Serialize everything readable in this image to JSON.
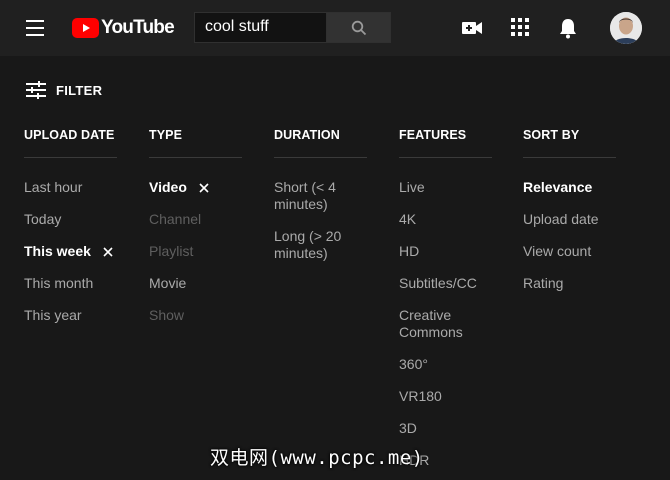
{
  "header": {
    "logo_text": "YouTube",
    "search_value": "cool stuff"
  },
  "filter": {
    "label": "FILTER"
  },
  "columns": [
    {
      "title": "UPLOAD DATE",
      "options": [
        {
          "label": "Last hour",
          "state": "normal"
        },
        {
          "label": "Today",
          "state": "normal"
        },
        {
          "label": "This week",
          "state": "selected"
        },
        {
          "label": "This month",
          "state": "normal"
        },
        {
          "label": "This year",
          "state": "normal"
        }
      ]
    },
    {
      "title": "TYPE",
      "options": [
        {
          "label": "Video",
          "state": "selected"
        },
        {
          "label": "Channel",
          "state": "disabled"
        },
        {
          "label": "Playlist",
          "state": "disabled"
        },
        {
          "label": "Movie",
          "state": "normal"
        },
        {
          "label": "Show",
          "state": "disabled"
        }
      ]
    },
    {
      "title": "DURATION",
      "options": [
        {
          "label": "Short (< 4 minutes)",
          "state": "normal"
        },
        {
          "label": "Long (> 20 minutes)",
          "state": "normal"
        }
      ]
    },
    {
      "title": "FEATURES",
      "options": [
        {
          "label": "Live",
          "state": "normal"
        },
        {
          "label": "4K",
          "state": "normal"
        },
        {
          "label": "HD",
          "state": "normal"
        },
        {
          "label": "Subtitles/CC",
          "state": "normal"
        },
        {
          "label": "Creative Commons",
          "state": "normal"
        },
        {
          "label": "360°",
          "state": "normal"
        },
        {
          "label": "VR180",
          "state": "normal"
        },
        {
          "label": "3D",
          "state": "normal"
        },
        {
          "label": "HDR",
          "state": "normal"
        }
      ]
    },
    {
      "title": "SORT BY",
      "options": [
        {
          "label": "Relevance",
          "state": "selected"
        },
        {
          "label": "Upload date",
          "state": "normal"
        },
        {
          "label": "View count",
          "state": "normal"
        },
        {
          "label": "Rating",
          "state": "normal"
        }
      ]
    }
  ],
  "watermark": "双电网(www.pcpc.me)",
  "icons": {
    "menu": "hamburger-menu-icon",
    "search": "search-icon",
    "create": "video-camera-plus-icon",
    "apps": "apps-grid-icon",
    "notifications": "bell-icon",
    "filter": "sliders-icon",
    "clear": "close-icon"
  },
  "colors": {
    "background": "#181818",
    "topbar": "#202020",
    "brand_red": "#ff0000",
    "selected_text": "#ffffff",
    "normal_text": "#aaaaaa",
    "disabled_text": "#5f5f5f"
  }
}
